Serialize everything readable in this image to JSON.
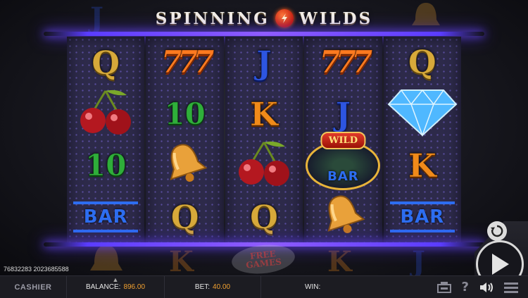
{
  "title": {
    "left_word": "SPINNING",
    "right_word": "WILDS"
  },
  "reels": [
    [
      {
        "type": "letter",
        "text": "Q",
        "color": "gold"
      },
      {
        "type": "cherry"
      },
      {
        "type": "ten",
        "text": "10"
      },
      {
        "type": "bar",
        "text": "BAR"
      }
    ],
    [
      {
        "type": "sevens",
        "text": "777"
      },
      {
        "type": "ten",
        "text": "10"
      },
      {
        "type": "bell"
      },
      {
        "type": "letter",
        "text": "Q",
        "color": "gold"
      }
    ],
    [
      {
        "type": "letter",
        "text": "J",
        "color": "blue"
      },
      {
        "type": "letter",
        "text": "K",
        "color": "orange"
      },
      {
        "type": "cherry"
      },
      {
        "type": "letter",
        "text": "Q",
        "color": "gold"
      }
    ],
    [
      {
        "type": "sevens",
        "text": "777"
      },
      {
        "type": "letter",
        "text": "J",
        "color": "blue"
      },
      {
        "type": "wild",
        "label": "WILD",
        "text": "BAR"
      },
      {
        "type": "bell"
      }
    ],
    [
      {
        "type": "letter",
        "text": "Q",
        "color": "gold"
      },
      {
        "type": "diamond"
      },
      {
        "type": "letter",
        "text": "K",
        "color": "orange"
      },
      {
        "type": "bar",
        "text": "BAR"
      }
    ]
  ],
  "free_games": {
    "line1": "FREE",
    "line2": "GAMES"
  },
  "ids": "76832283  2023685588",
  "bottom_bar": {
    "cashier": "CASHIER",
    "balance_label": "BALANCE:",
    "balance_value": "896.00",
    "bet_label": "BET:",
    "bet_value": "40.00",
    "win_label": "WIN:"
  },
  "icons": [
    "paytable-icon",
    "help-icon",
    "sound-icon",
    "menu-icon"
  ],
  "colors": {
    "neon": "#6d4bff",
    "accent": "#f0a030",
    "reel_bg": "#2d2a4a"
  }
}
